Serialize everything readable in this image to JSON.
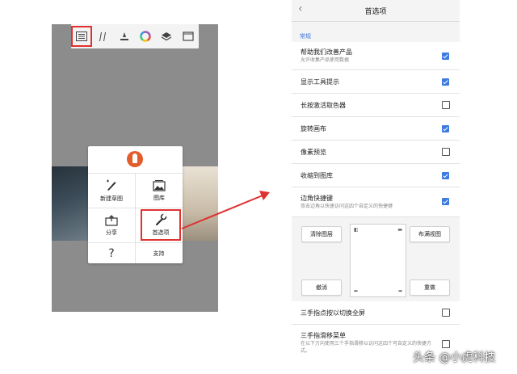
{
  "toolbar": {
    "icons": [
      "layers-panel-icon",
      "brush-icon",
      "fill-icon",
      "color-wheel-icon",
      "stack-icon",
      "canvas-icon"
    ]
  },
  "menu": {
    "items": [
      {
        "label": "新建草图",
        "icon": "new-sketch-icon"
      },
      {
        "label": "图库",
        "icon": "gallery-icon"
      },
      {
        "label": "分享",
        "icon": "share-icon"
      },
      {
        "label": "首选项",
        "icon": "wrench-icon"
      }
    ],
    "help_icon": "question-icon",
    "support_label": "支持"
  },
  "settings": {
    "title": "首选项",
    "back_icon": "chevron-left-icon",
    "section": "常规",
    "rows": [
      {
        "label": "帮助我们改善产品",
        "sub": "允许收集产品使用数据",
        "checked": true
      },
      {
        "label": "显示工具提示",
        "sub": "",
        "checked": true
      },
      {
        "label": "长按激活取色器",
        "sub": "",
        "checked": false
      },
      {
        "label": "旋转画布",
        "sub": "",
        "checked": true
      },
      {
        "label": "像素预览",
        "sub": "",
        "checked": false
      },
      {
        "label": "收缩到图库",
        "sub": "",
        "checked": true
      },
      {
        "label": "边角快捷键",
        "sub": "双击边角以快速访问这四个自定义的快捷键",
        "checked": true
      }
    ],
    "corner_buttons": {
      "top_left": "清除图层",
      "top_right": "布满视图",
      "bottom_left": "撤消",
      "bottom_right": "重做"
    },
    "bottom_rows": [
      {
        "label": "三手指点按以切换全屏",
        "sub": "",
        "checked": false
      },
      {
        "label": "三手指滑移菜单",
        "sub": "在以下方向使用三个手指滑移以访问这四个可自定义的快捷方式。",
        "checked": false
      }
    ]
  },
  "watermark": "头条 @小虎科技",
  "colors": {
    "accent": "#3d7be0",
    "highlight": "#e03131",
    "section": "#3b73d9"
  }
}
